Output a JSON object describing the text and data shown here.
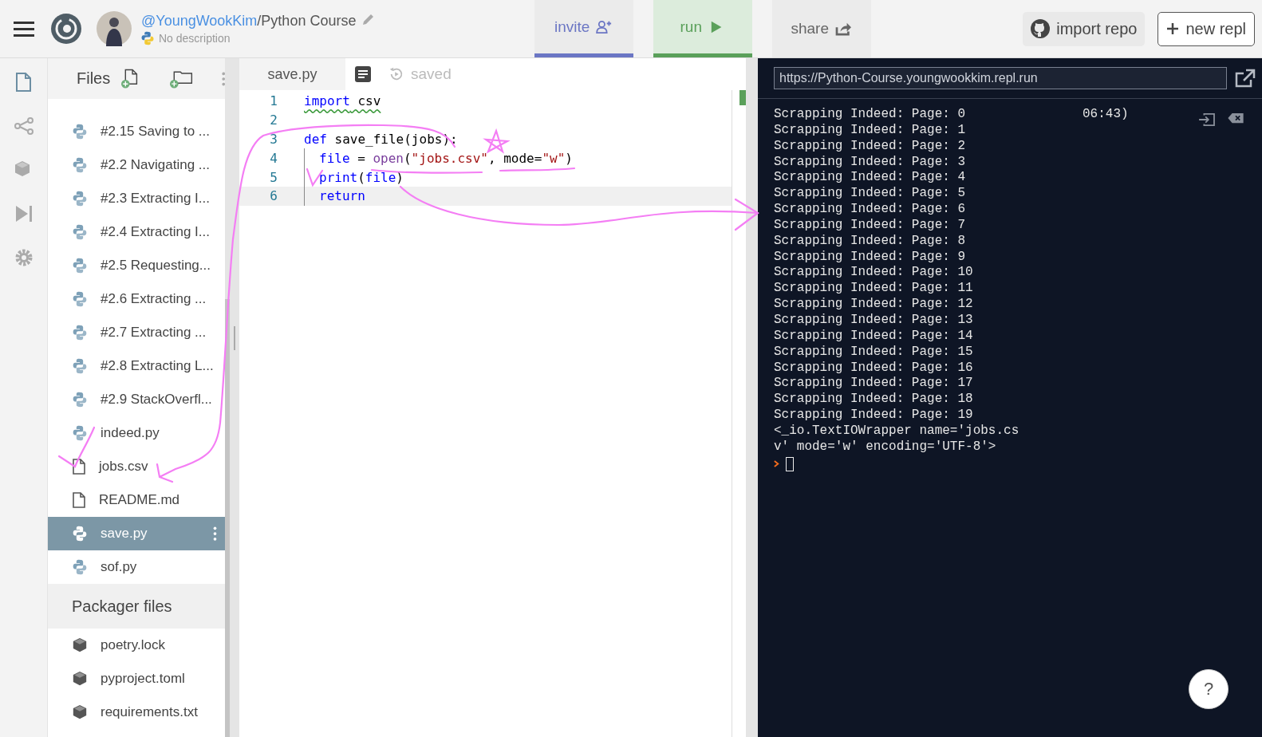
{
  "header": {
    "owner": "@YoungWookKim",
    "project": "/Python Course",
    "description": "No description",
    "tabs": [
      {
        "label": "invite",
        "kind": "invite"
      },
      {
        "label": "run",
        "kind": "run"
      },
      {
        "label": "share",
        "kind": "share"
      }
    ],
    "import_repo": "import repo",
    "new_repl": "new repl"
  },
  "files": {
    "title": "Files",
    "items": [
      {
        "name": "#2.15 Saving to ...",
        "kind": "python",
        "selected": false
      },
      {
        "name": "#2.2 Navigating ...",
        "kind": "python",
        "selected": false
      },
      {
        "name": "#2.3 Extracting I...",
        "kind": "python",
        "selected": false
      },
      {
        "name": "#2.4 Extracting I...",
        "kind": "python",
        "selected": false
      },
      {
        "name": "#2.5 Requesting...",
        "kind": "python",
        "selected": false
      },
      {
        "name": "#2.6 Extracting ...",
        "kind": "python",
        "selected": false
      },
      {
        "name": "#2.7 Extracting ...",
        "kind": "python",
        "selected": false
      },
      {
        "name": "#2.8 Extracting L...",
        "kind": "python",
        "selected": false
      },
      {
        "name": "#2.9 StackOverfl...",
        "kind": "python",
        "selected": false
      },
      {
        "name": "indeed.py",
        "kind": "python",
        "selected": false
      },
      {
        "name": "jobs.csv",
        "kind": "file",
        "selected": false
      },
      {
        "name": "README.md",
        "kind": "file",
        "selected": false
      },
      {
        "name": "save.py",
        "kind": "python",
        "selected": true
      },
      {
        "name": "sof.py",
        "kind": "python",
        "selected": false
      }
    ],
    "packager_title": "Packager files",
    "packager_items": [
      "poetry.lock",
      "pyproject.toml",
      "requirements.txt"
    ]
  },
  "editor": {
    "tab": "save.py",
    "status": "saved",
    "lines": [
      {
        "number": "1",
        "indented": false,
        "selected": false,
        "tokens": [
          {
            "text": "import",
            "kind": "keyword"
          },
          {
            "text": " csv",
            "kind": "plain"
          }
        ]
      },
      {
        "number": "2",
        "indented": false,
        "selected": false
      },
      {
        "number": "3",
        "indented": false,
        "selected": false,
        "tokens": [
          {
            "text": "def",
            "kind": "keyword"
          },
          {
            "text": " save_file(jobs):",
            "kind": "plain"
          }
        ]
      },
      {
        "number": "4",
        "indented": true,
        "selected": false,
        "tokens": [
          {
            "text": "file",
            "kind": "keyword"
          },
          {
            "text": " = ",
            "kind": "plain"
          },
          {
            "text": "open",
            "kind": "builtin"
          },
          {
            "text": "(",
            "kind": "plain"
          },
          {
            "text": "\"jobs.csv\"",
            "kind": "string"
          },
          {
            "text": ", mode=",
            "kind": "plain"
          },
          {
            "text": "\"w\"",
            "kind": "string"
          },
          {
            "text": ")",
            "kind": "plain"
          }
        ]
      },
      {
        "number": "5",
        "indented": true,
        "selected": false,
        "tokens": [
          {
            "text": "print",
            "kind": "keyword"
          },
          {
            "text": "(",
            "kind": "plain"
          },
          {
            "text": "file",
            "kind": "keyword"
          },
          {
            "text": ")",
            "kind": "plain"
          }
        ]
      },
      {
        "number": "6",
        "indented": true,
        "selected": true,
        "tokens": [
          {
            "text": "return",
            "kind": "keyword"
          }
        ]
      }
    ]
  },
  "console": {
    "url": "https://Python-Course.youngwookkim.repl.run",
    "time": "06:43)",
    "lines": [
      "Scrapping Indeed: Page: 0",
      "Scrapping Indeed: Page: 1",
      "Scrapping Indeed: Page: 2",
      "Scrapping Indeed: Page: 3",
      "Scrapping Indeed: Page: 4",
      "Scrapping Indeed: Page: 5",
      "Scrapping Indeed: Page: 6",
      "Scrapping Indeed: Page: 7",
      "Scrapping Indeed: Page: 8",
      "Scrapping Indeed: Page: 9",
      "Scrapping Indeed: Page: 10",
      "Scrapping Indeed: Page: 11",
      "Scrapping Indeed: Page: 12",
      "Scrapping Indeed: Page: 13",
      "Scrapping Indeed: Page: 14",
      "Scrapping Indeed: Page: 15",
      "Scrapping Indeed: Page: 16",
      "Scrapping Indeed: Page: 17",
      "Scrapping Indeed: Page: 18",
      "Scrapping Indeed: Page: 19",
      "<_io.TextIOWrapper name='jobs.cs",
      "v' mode='w' encoding='UTF-8'>"
    ]
  },
  "help": "?"
}
